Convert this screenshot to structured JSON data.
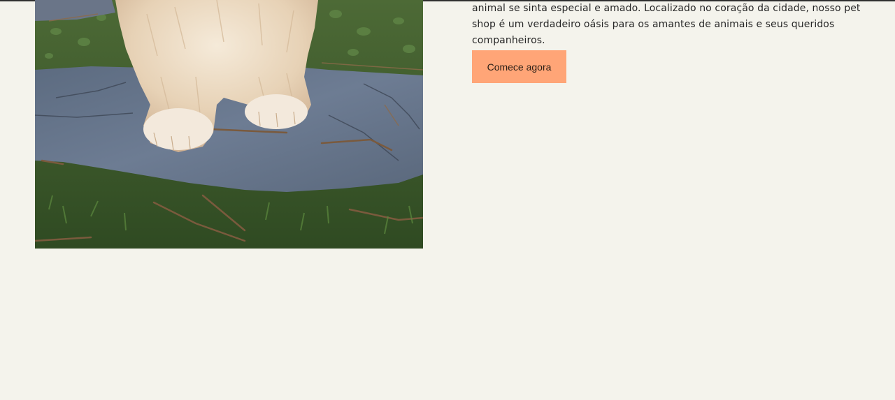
{
  "about": {
    "description": "animal se sinta especial e amado. Localizado no coração da cidade, nosso pet shop é um verdadeiro oásis para os amantes de animais e seus queridos companheiros.",
    "cta_label": "Comece agora"
  },
  "photo": {
    "subject": "fluffy-white-dog-on-stone-path"
  },
  "colors": {
    "background": "#f4f3ec",
    "accent": "#ffa577",
    "text": "#262626"
  }
}
